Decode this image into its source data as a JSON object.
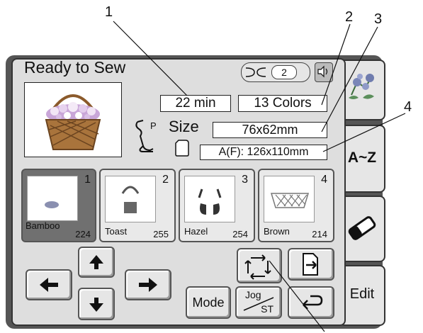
{
  "callouts": [
    "1",
    "2",
    "3",
    "4"
  ],
  "header": {
    "title": "Ready to Sew"
  },
  "thread": {
    "count": "2"
  },
  "info": {
    "time": "22 min",
    "colors": "13 Colors",
    "size_label": "Size",
    "presser_foot": "P",
    "size_value": "76x62mm",
    "hoop": "A(F): 126x110mm"
  },
  "patterns": [
    {
      "number": "1",
      "name": "Bamboo",
      "stitches": "224",
      "selected": true
    },
    {
      "number": "2",
      "name": "Toast",
      "stitches": "255"
    },
    {
      "number": "3",
      "name": "Hazel",
      "stitches": "254"
    },
    {
      "number": "4",
      "name": "Brown",
      "stitches": "214"
    }
  ],
  "buttons": {
    "mode": "Mode",
    "jog_top": "Jog",
    "jog_bottom": "ST"
  },
  "tabs": {
    "az": "A~Z",
    "edit": "Edit"
  },
  "icons": [
    "thread-icon",
    "speaker-icon",
    "flower-icon",
    "presser-foot-icon",
    "hoop-icon",
    "arrow-up-icon",
    "arrow-down-icon",
    "arrow-left-icon",
    "arrow-right-icon",
    "rotate-icon",
    "file-arrow-icon",
    "return-icon",
    "eraser-icon"
  ],
  "colors": {
    "panel": "#555555",
    "screen": "#dedede",
    "selected": "#707070"
  }
}
